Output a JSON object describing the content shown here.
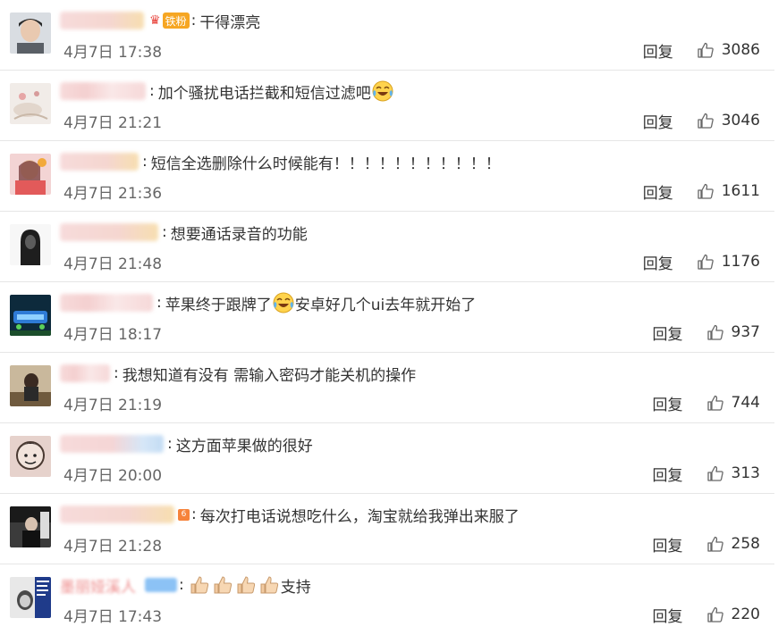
{
  "actions": {
    "reply_label": "回复"
  },
  "comments": [
    {
      "badge_label": "铁粉",
      "text": "干得漂亮",
      "time": "4月7日 17:38",
      "likes": "3086"
    },
    {
      "text": "加个骚扰电话拦截和短信过滤吧",
      "time": "4月7日 21:21",
      "likes": "3046"
    },
    {
      "text": "短信全选删除什么时候能有！！！！！！！！！！！",
      "time": "4月7日 21:36",
      "likes": "1611"
    },
    {
      "text": "想要通话录音的功能",
      "time": "4月7日 21:48",
      "likes": "1176"
    },
    {
      "text_a": "苹果终于跟牌了",
      "text_b": "安卓好几个ui去年就开始了",
      "time": "4月7日 18:17",
      "likes": "937"
    },
    {
      "text": "我想知道有没有 需输入密码才能关机的操作",
      "time": "4月7日 21:19",
      "likes": "744"
    },
    {
      "text": "这方面苹果做的很好",
      "time": "4月7日 20:00",
      "likes": "313"
    },
    {
      "text": "每次打电话说想吃什么，淘宝就给我弹出来服了",
      "time": "4月7日 21:28",
      "likes": "258"
    },
    {
      "name_visible": "墨丽娅溪人",
      "text": "支持",
      "time": "4月7日 17:43",
      "likes": "220"
    }
  ],
  "icons": {
    "like": "thumbs-up-outline-icon",
    "laugh_cry": "laughing-tears-emoji-icon",
    "clap": "thumbs-up-hand-emoji-icon"
  }
}
